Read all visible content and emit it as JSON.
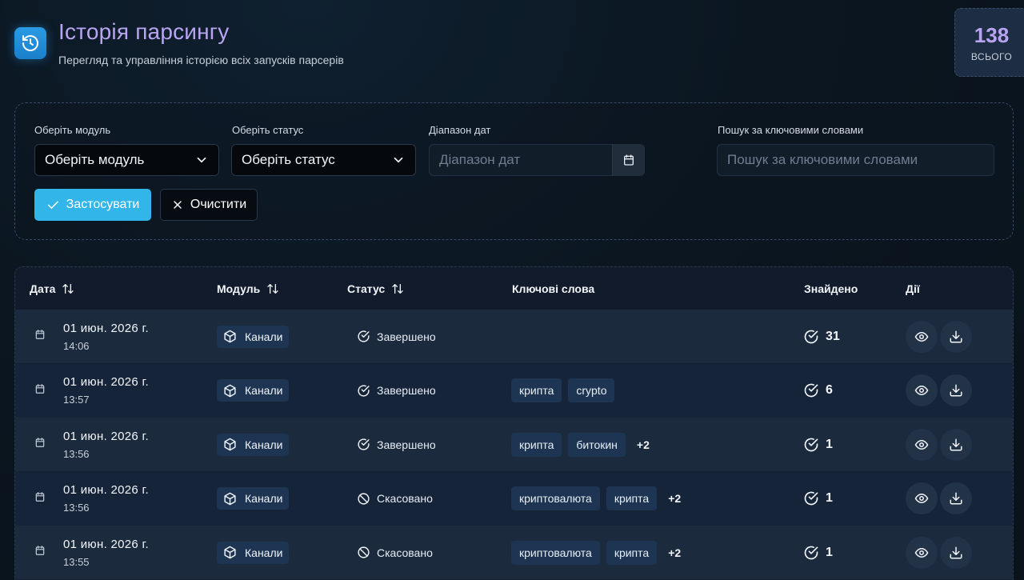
{
  "header": {
    "title": "Історія парсингу",
    "subtitle": "Перегляд та управління історією всіх запусків парсерів",
    "total_value": "138",
    "total_label": "ВСЬОГО"
  },
  "filters": {
    "module_label": "Оберіть модуль",
    "module_value": "Оберіть модуль",
    "status_label": "Оберіть статус",
    "status_value": "Оберіть статус",
    "date_label": "Діапазон дат",
    "date_placeholder": "Діапазон дат",
    "search_label": "Пошук за ключовими словами",
    "search_placeholder": "Пошук за ключовими словами",
    "apply_label": "Застосувати",
    "clear_label": "Очистити"
  },
  "table": {
    "columns": {
      "date": "Дата",
      "module": "Модуль",
      "status": "Статус",
      "keywords": "Ключові слова",
      "found": "Знайдено",
      "actions": "Дії"
    },
    "rows": [
      {
        "date": "01 июн. 2026 г.",
        "time": "14:06",
        "module": "Канали",
        "status": "Завершено",
        "status_type": "done",
        "keywords": [],
        "more": "",
        "found": "31"
      },
      {
        "date": "01 июн. 2026 г.",
        "time": "13:57",
        "module": "Канали",
        "status": "Завершено",
        "status_type": "done",
        "keywords": [
          "крипта",
          "crypto"
        ],
        "more": "",
        "found": "6"
      },
      {
        "date": "01 июн. 2026 г.",
        "time": "13:56",
        "module": "Канали",
        "status": "Завершено",
        "status_type": "done",
        "keywords": [
          "крипта",
          "битокин"
        ],
        "more": "+2",
        "found": "1"
      },
      {
        "date": "01 июн. 2026 г.",
        "time": "13:56",
        "module": "Канали",
        "status": "Скасовано",
        "status_type": "cancelled",
        "keywords": [
          "криптовалюта",
          "крипта"
        ],
        "more": "+2",
        "found": "1"
      },
      {
        "date": "01 июн. 2026 г.",
        "time": "13:55",
        "module": "Канали",
        "status": "Скасовано",
        "status_type": "cancelled",
        "keywords": [
          "криптовалюта",
          "крипта"
        ],
        "more": "+2",
        "found": "1"
      }
    ]
  },
  "colors": {
    "accent": "#32b6ea",
    "title": "#b8a4f0",
    "chip": "#1d3552"
  }
}
